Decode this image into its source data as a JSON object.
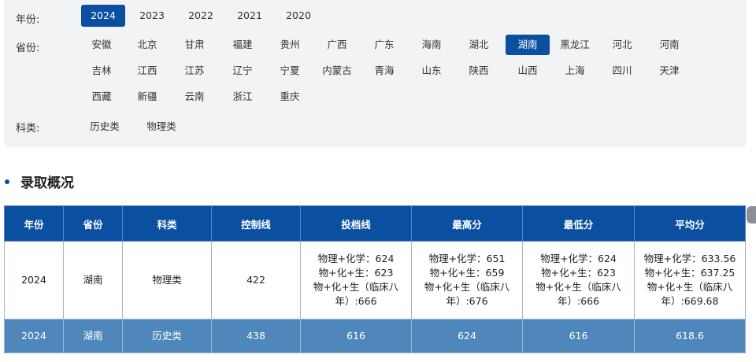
{
  "filters": {
    "year": {
      "label": "年份:",
      "options": [
        "2024",
        "2023",
        "2022",
        "2021",
        "2020"
      ],
      "selected": "2024"
    },
    "province": {
      "label": "省份:",
      "options": [
        "安徽",
        "北京",
        "甘肃",
        "福建",
        "贵州",
        "广西",
        "广东",
        "海南",
        "湖北",
        "湖南",
        "黑龙江",
        "河北",
        "河南",
        "吉林",
        "江西",
        "江苏",
        "辽宁",
        "宁夏",
        "内蒙古",
        "青海",
        "山东",
        "陕西",
        "山西",
        "上海",
        "四川",
        "天津",
        "西藏",
        "新疆",
        "云南",
        "浙江",
        "重庆"
      ],
      "selected": "湖南"
    },
    "subject": {
      "label": "科类:",
      "options": [
        "历史类",
        "物理类"
      ]
    }
  },
  "section": {
    "title": "录取概况"
  },
  "table": {
    "headers": [
      "年份",
      "省份",
      "科类",
      "控制线",
      "投档线",
      "最高分",
      "最低分",
      "平均分"
    ],
    "rows": [
      [
        "2024",
        "湖南",
        "物理类",
        "422",
        "物理+化学：624\n物+化+生：623\n物+化+生（临床八年）:666",
        "物理+化学：651\n物+化+生：659\n物+化+生（临床八年）:676",
        "物理+化学：624\n物+化+生：623\n物+化+生（临床八年）:666",
        "物理+化学：633.56\n物+化+生：637.25\n物+化+生（临床八年）:669.68"
      ],
      [
        "2024",
        "湖南",
        "历史类",
        "438",
        "616",
        "624",
        "616",
        "618.6"
      ]
    ]
  },
  "colors": {
    "accent": "#0b4fa0",
    "row_highlight": "#4f87bd",
    "panel_bg": "#f2f3f5"
  }
}
